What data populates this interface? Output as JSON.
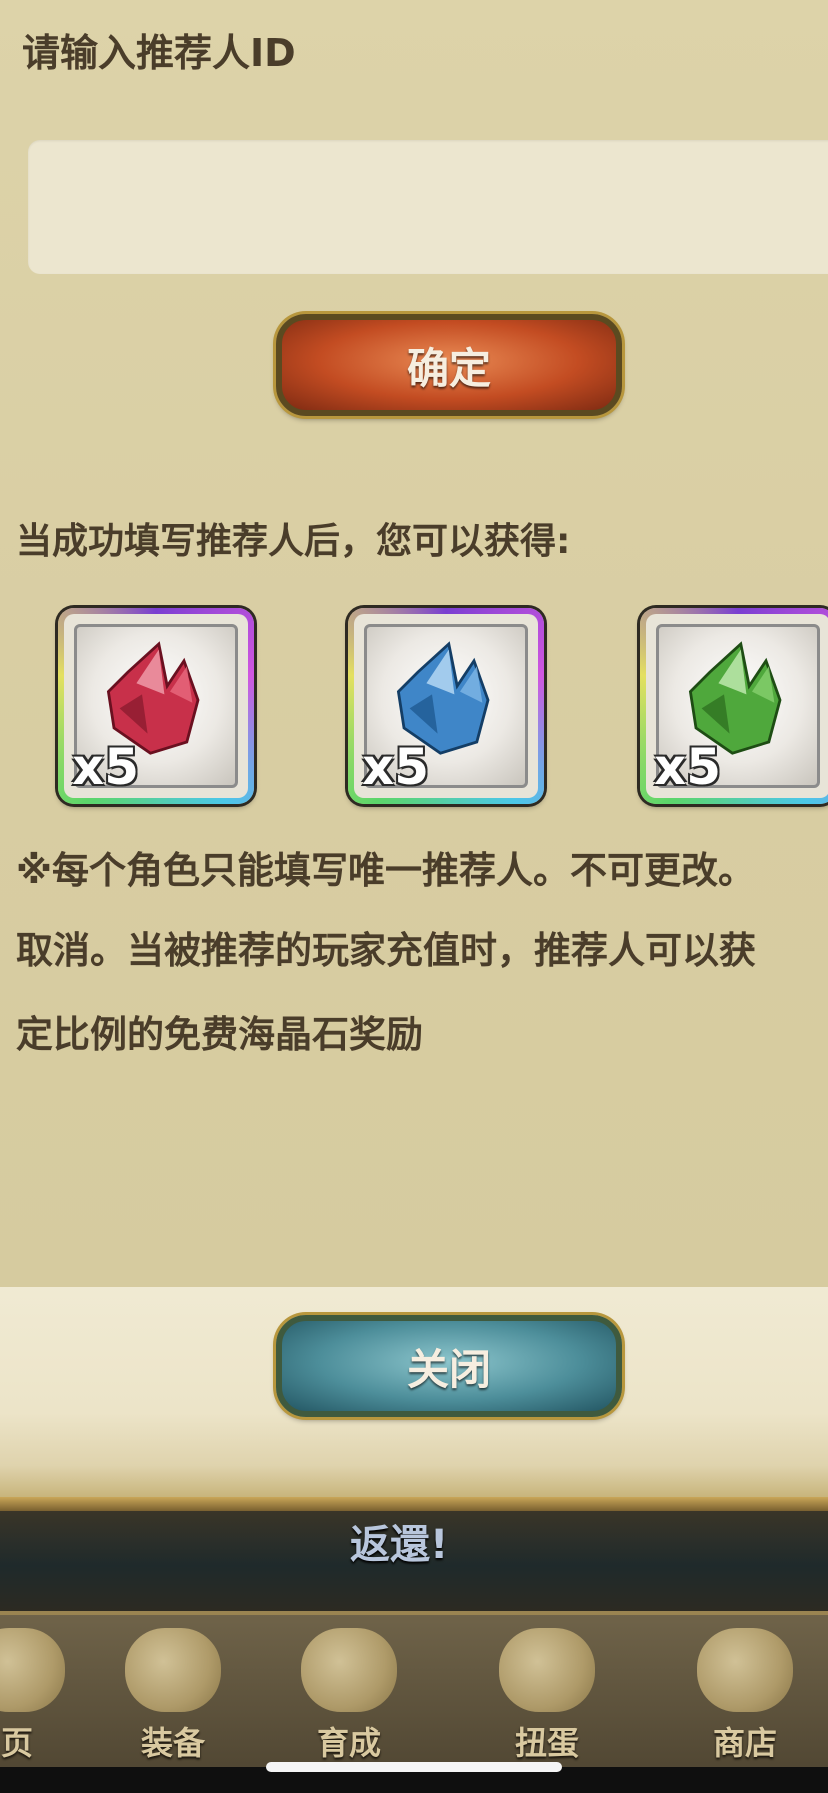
{
  "dialog": {
    "prompt": "请输入推荐人ID",
    "id_input_value": "",
    "confirm_label": "确定",
    "reward_intro": "当成功填写推荐人后，您可以获得:",
    "rewards": [
      {
        "item": "red-crystal",
        "count": "x5",
        "color": "#c8304a"
      },
      {
        "item": "blue-crystal",
        "count": "x5",
        "color": "#3f86c8"
      },
      {
        "item": "green-crystal",
        "count": "x5",
        "color": "#4fa83c"
      }
    ],
    "notice_lines": [
      "※每个角色只能填写唯一推荐人。不可更改。",
      "取消。当被推荐的玩家充值时，推荐人可以获",
      "定比例的免费海晶石奖励"
    ],
    "close_label": "关闭"
  },
  "background": {
    "banner_text": "返還!"
  },
  "nav": {
    "items": [
      {
        "label": "页",
        "icon": "home-icon"
      },
      {
        "label": "装备",
        "icon": "helmet-icon"
      },
      {
        "label": "育成",
        "icon": "sword-icon"
      },
      {
        "label": "扭蛋",
        "icon": "capsule-pouch-icon"
      },
      {
        "label": "商店",
        "icon": "coin-bag-icon"
      }
    ]
  }
}
